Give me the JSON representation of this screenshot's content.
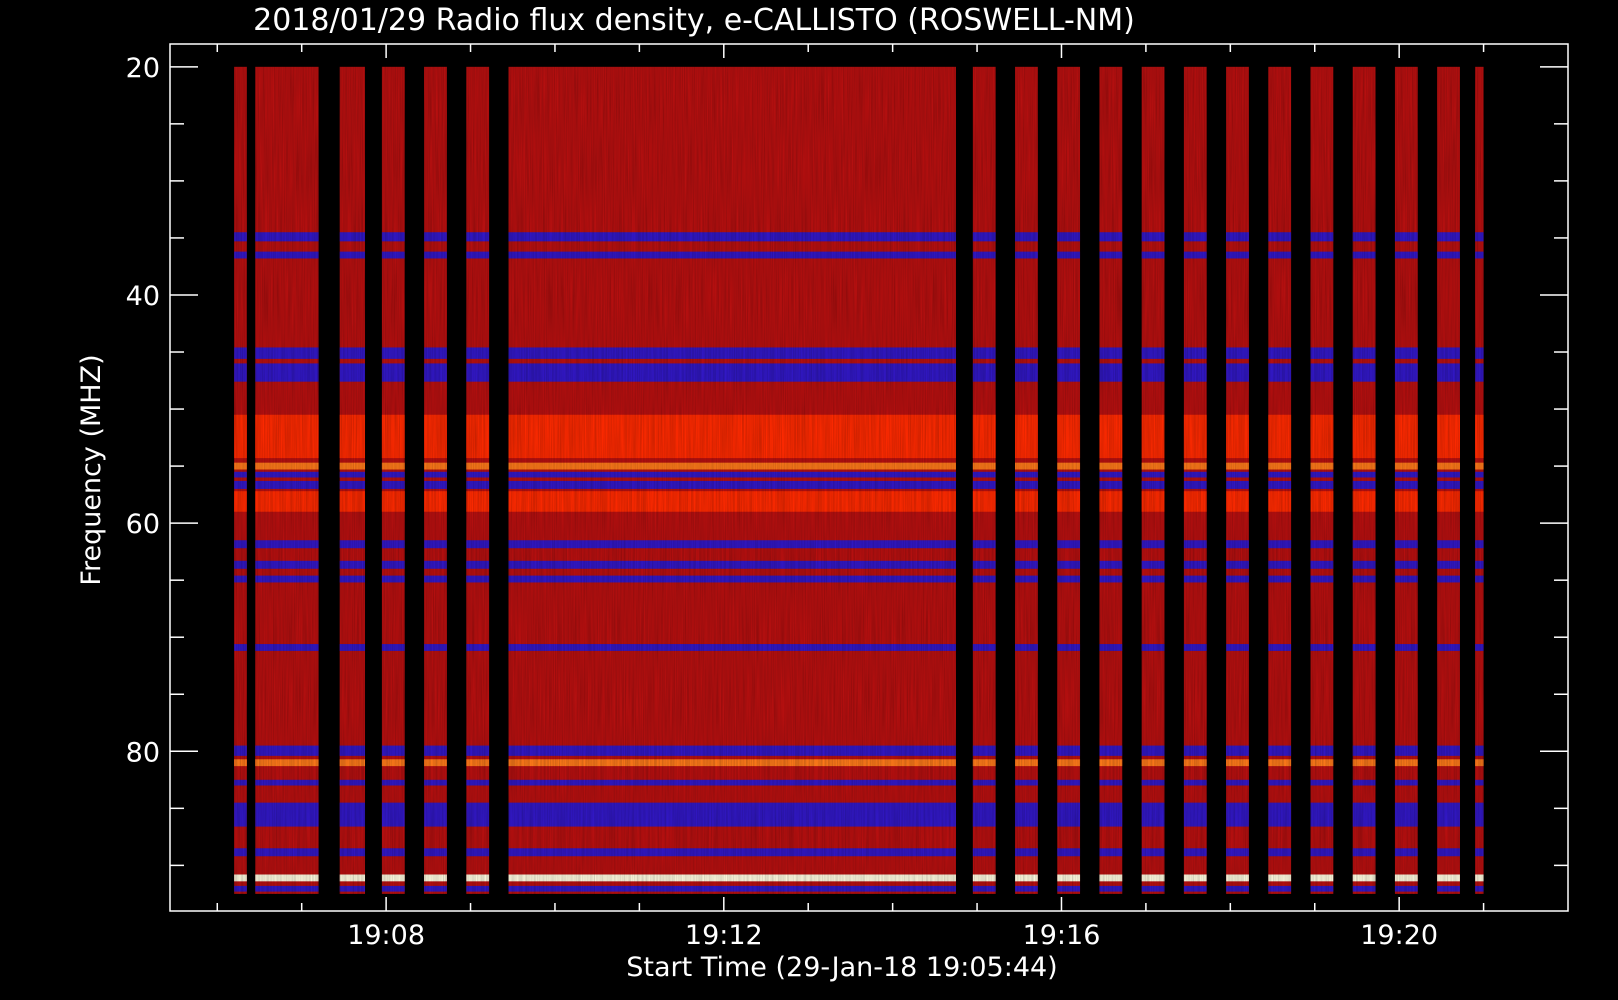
{
  "chart_data": {
    "type": "heatmap",
    "title": "2018/01/29  Radio flux density, e-CALLISTO (ROSWELL-NM)",
    "xlabel": "Start Time (29-Jan-18 19:05:44)",
    "ylabel": "Frequency (MHZ)",
    "x_ticks": [
      "19:08",
      "19:12",
      "19:16",
      "19:20"
    ],
    "x_tick_minutes": [
      8,
      12,
      16,
      20
    ],
    "x_range_minutes": [
      5.44,
      22.0
    ],
    "y_ticks": [
      "20",
      "40",
      "60",
      "80"
    ],
    "y_tick_values": [
      20,
      40,
      60,
      80
    ],
    "y_range": [
      18,
      94
    ],
    "data_freq_range": [
      20,
      92.5
    ],
    "grid": false,
    "colormap": "red-temperature",
    "data_segments_minutes": [
      [
        6.2,
        6.35
      ],
      [
        6.45,
        7.2
      ],
      [
        7.45,
        7.75
      ],
      [
        7.95,
        8.22
      ],
      [
        8.45,
        8.72
      ],
      [
        8.95,
        9.22
      ],
      [
        9.45,
        14.75
      ],
      [
        14.95,
        15.22
      ],
      [
        15.45,
        15.72
      ],
      [
        15.95,
        16.22
      ],
      [
        16.45,
        16.72
      ],
      [
        16.95,
        17.22
      ],
      [
        17.45,
        17.72
      ],
      [
        17.95,
        18.22
      ],
      [
        18.45,
        18.72
      ],
      [
        18.95,
        19.22
      ],
      [
        19.45,
        19.72
      ],
      [
        19.95,
        20.22
      ],
      [
        20.45,
        20.72
      ],
      [
        20.9,
        21.0
      ]
    ],
    "frequency_bands_mhz": [
      {
        "f0": 34.5,
        "f1": 35.3,
        "level": "low"
      },
      {
        "f0": 36.2,
        "f1": 36.8,
        "level": "low"
      },
      {
        "f0": 44.6,
        "f1": 45.6,
        "level": "low"
      },
      {
        "f0": 46.0,
        "f1": 47.6,
        "level": "low"
      },
      {
        "f0": 50.5,
        "f1": 54.3,
        "level": "high"
      },
      {
        "f0": 54.7,
        "f1": 55.3,
        "level": "peak"
      },
      {
        "f0": 55.5,
        "f1": 56.0,
        "level": "low"
      },
      {
        "f0": 56.3,
        "f1": 57.0,
        "level": "low"
      },
      {
        "f0": 57.2,
        "f1": 59.0,
        "level": "high"
      },
      {
        "f0": 61.5,
        "f1": 62.2,
        "level": "low"
      },
      {
        "f0": 63.3,
        "f1": 64.0,
        "level": "low"
      },
      {
        "f0": 64.6,
        "f1": 65.2,
        "level": "low"
      },
      {
        "f0": 70.6,
        "f1": 71.2,
        "level": "low"
      },
      {
        "f0": 79.5,
        "f1": 80.4,
        "level": "low"
      },
      {
        "f0": 80.7,
        "f1": 81.3,
        "level": "peak"
      },
      {
        "f0": 82.5,
        "f1": 83.0,
        "level": "low"
      },
      {
        "f0": 84.5,
        "f1": 86.6,
        "level": "low"
      },
      {
        "f0": 88.5,
        "f1": 89.2,
        "level": "low"
      },
      {
        "f0": 90.8,
        "f1": 91.4,
        "level": "max"
      },
      {
        "f0": 91.8,
        "f1": 92.3,
        "level": "low"
      }
    ],
    "colors": {
      "background": "#000000",
      "base": "#b81010",
      "high": "#ff2a00",
      "peak": "#ff7a1a",
      "max": "#fffbe0",
      "low": "#1a1ae6",
      "axis": "#ffffff"
    }
  }
}
